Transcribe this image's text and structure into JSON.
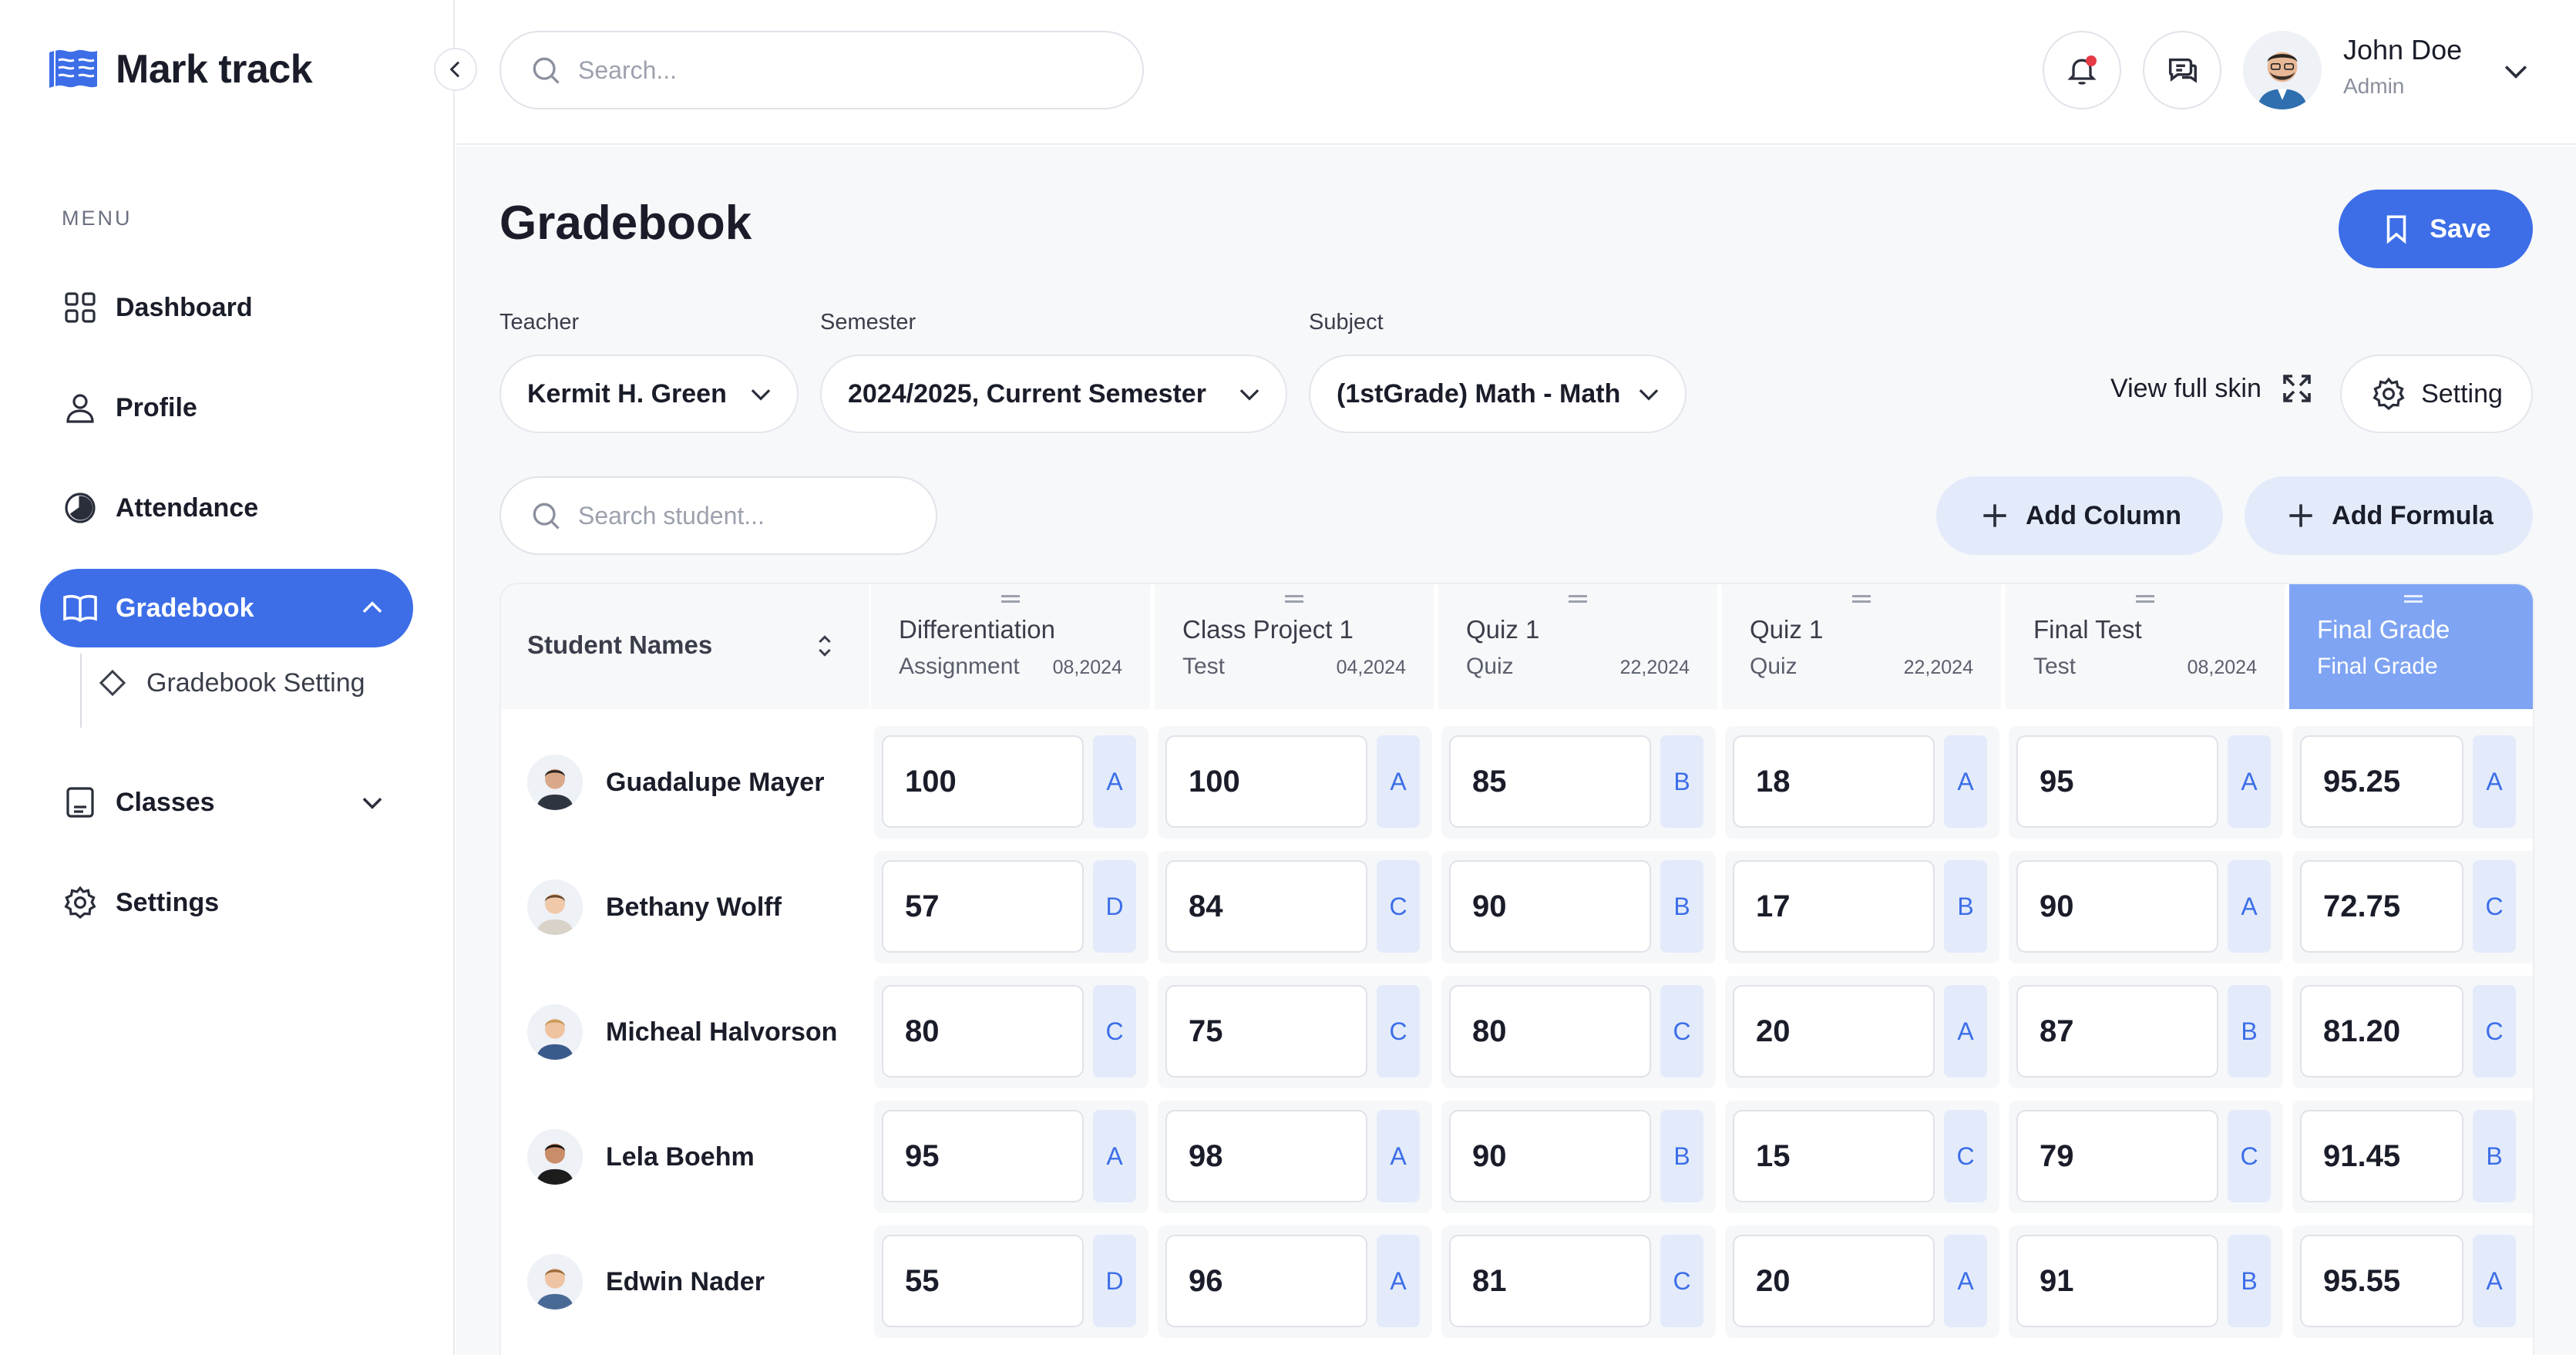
{
  "app": {
    "name": "Mark track"
  },
  "sidebar": {
    "menu_title": "MENU",
    "items": [
      {
        "label": "Dashboard",
        "icon": "grid-icon"
      },
      {
        "label": "Profile",
        "icon": "user-icon"
      },
      {
        "label": "Attendance",
        "icon": "pie-icon"
      },
      {
        "label": "Gradebook",
        "icon": "book-icon",
        "active": true
      },
      {
        "label": "Classes",
        "icon": "notebook-icon"
      },
      {
        "label": "Settings",
        "icon": "gear-icon"
      }
    ],
    "sub_items": [
      {
        "label": "Gradebook Setting",
        "icon": "diamond-icon"
      }
    ]
  },
  "header": {
    "search_placeholder": "Search...",
    "user": {
      "name": "John Doe",
      "role": "Admin"
    }
  },
  "page": {
    "title": "Gradebook",
    "save_label": "Save",
    "filters": {
      "teacher": {
        "label": "Teacher",
        "value": "Kermit H. Green"
      },
      "semester": {
        "label": "Semester",
        "value": "2024/2025, Current Semester"
      },
      "subject": {
        "label": "Subject",
        "value": "(1stGrade) Math - Math"
      }
    },
    "view_full_label": "View full skin",
    "setting_label": "Setting",
    "student_search_placeholder": "Search student...",
    "add_column_label": "Add Column",
    "add_formula_label": "Add Formula"
  },
  "table": {
    "student_header": "Student Names",
    "columns": [
      {
        "name": "Differentiation",
        "type": "Assignment",
        "date": "08,2024"
      },
      {
        "name": "Class Project 1",
        "type": "Test",
        "date": "04,2024"
      },
      {
        "name": "Quiz 1",
        "type": "Quiz",
        "date": "22,2024"
      },
      {
        "name": "Quiz 1",
        "type": "Quiz",
        "date": "22,2024"
      },
      {
        "name": "Final Test",
        "type": "Test",
        "date": "08,2024"
      },
      {
        "name": "Final Grade",
        "type": "Final Grade",
        "date": ""
      }
    ],
    "rows": [
      {
        "name": "Guadalupe Mayer",
        "grades": [
          [
            "100",
            "A"
          ],
          [
            "100",
            "A"
          ],
          [
            "85",
            "B"
          ],
          [
            "18",
            "A"
          ],
          [
            "95",
            "A"
          ],
          [
            "95.25",
            "A"
          ]
        ]
      },
      {
        "name": "Bethany Wolff",
        "grades": [
          [
            "57",
            "D"
          ],
          [
            "84",
            "C"
          ],
          [
            "90",
            "B"
          ],
          [
            "17",
            "B"
          ],
          [
            "90",
            "A"
          ],
          [
            "72.75",
            "C"
          ]
        ]
      },
      {
        "name": "Micheal Halvorson",
        "grades": [
          [
            "80",
            "C"
          ],
          [
            "75",
            "C"
          ],
          [
            "80",
            "C"
          ],
          [
            "20",
            "A"
          ],
          [
            "87",
            "B"
          ],
          [
            "81.20",
            "C"
          ]
        ]
      },
      {
        "name": "Lela Boehm",
        "grades": [
          [
            "95",
            "A"
          ],
          [
            "98",
            "A"
          ],
          [
            "90",
            "B"
          ],
          [
            "15",
            "C"
          ],
          [
            "79",
            "C"
          ],
          [
            "91.45",
            "B"
          ]
        ]
      },
      {
        "name": "Edwin Nader",
        "grades": [
          [
            "55",
            "D"
          ],
          [
            "96",
            "A"
          ],
          [
            "81",
            "C"
          ],
          [
            "20",
            "A"
          ],
          [
            "91",
            "B"
          ],
          [
            "95.55",
            "A"
          ]
        ]
      }
    ]
  },
  "colors": {
    "primary": "#3d6ee8",
    "primary_light": "#e3ebfb",
    "final_header": "#7fa4f3",
    "notification_dot": "#e63946"
  }
}
